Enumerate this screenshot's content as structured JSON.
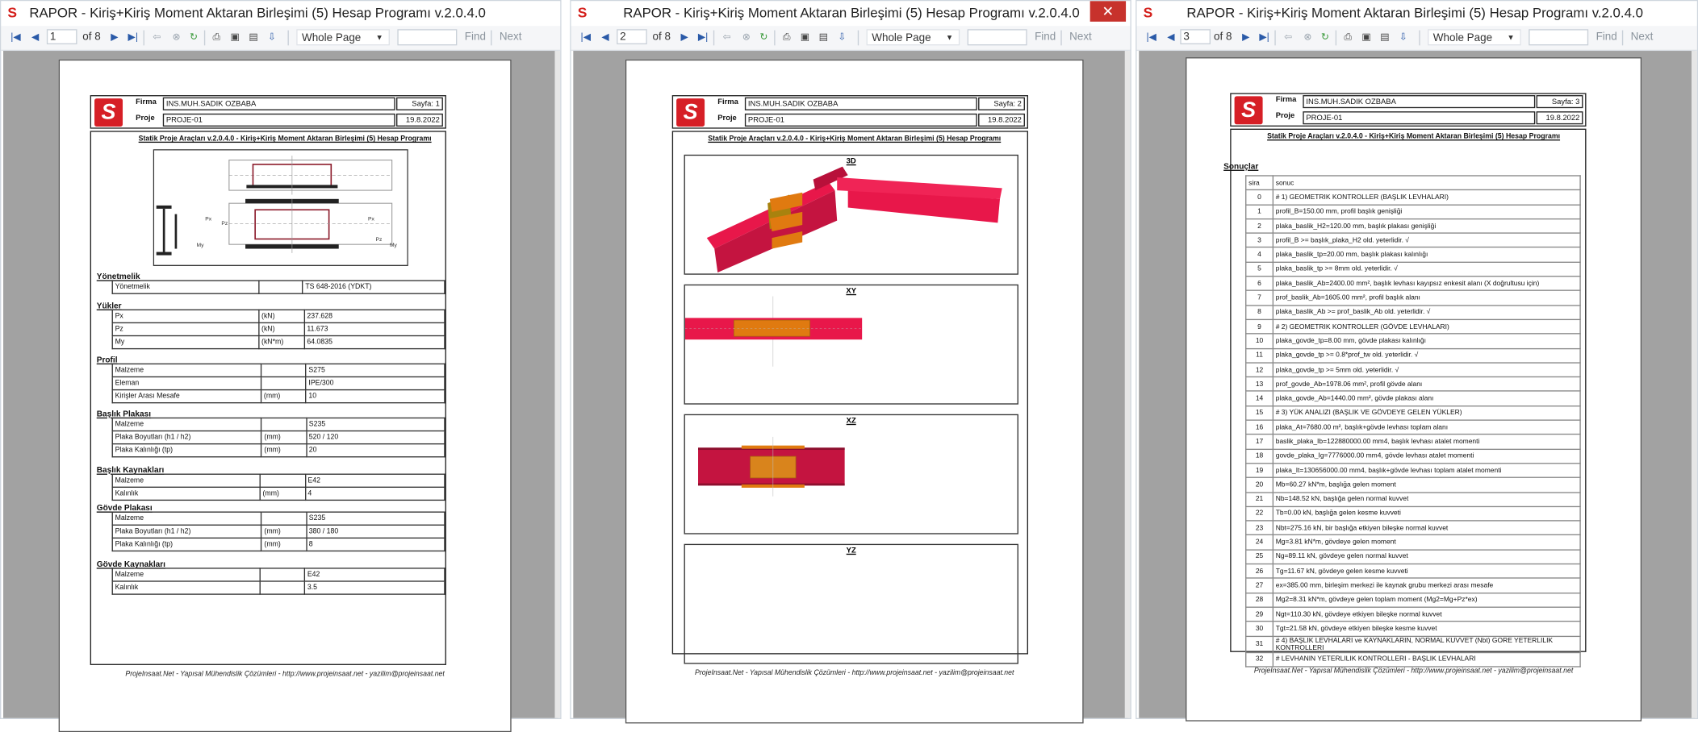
{
  "windows": [
    {
      "title": "RAPOR - Kiriş+Kiriş Moment Aktaran Birleşimi (5) Hesap Programı v.2.0.4.0",
      "page_input": "1",
      "page_of": "of 8",
      "zoom": "Whole Page",
      "find_label": "Find",
      "next_label": "Next",
      "page_label": "Sayfa: 1"
    },
    {
      "title": "RAPOR - Kiriş+Kiriş Moment Aktaran Birleşimi (5) Hesap Programı v.2.0.4.0",
      "page_input": "2",
      "page_of": "of 8",
      "zoom": "Whole Page",
      "find_label": "Find",
      "next_label": "Next",
      "page_label": "Sayfa: 2"
    },
    {
      "title": "RAPOR - Kiriş+Kiriş Moment Aktaran Birleşimi (5) Hesap Programı v.2.0.4.0",
      "page_input": "3",
      "page_of": "of 8",
      "zoom": "Whole Page",
      "find_label": "Find",
      "next_label": "Next",
      "page_label": "Sayfa: 3"
    }
  ],
  "report": {
    "firma_label": "Firma",
    "firma_value": "INS.MUH.SADIK OZBABA",
    "proje_label": "Proje",
    "proje_value": "PROJE-01",
    "date": "19.8.2022",
    "subtitle": "Statik Proje Araçları v.2.0.4.0 - Kiriş+Kiriş Moment Aktaran Birleşimi (5) Hesap Programı",
    "footer": "ProjeInsaat.Net - Yapısal Mühendislik Çözümleri - http://www.projeinsaat.net - yazilim@projeinsaat.net"
  },
  "page1": {
    "sections": [
      {
        "title": "Yönetmelik",
        "rows": [
          [
            "Yönetmelik",
            "",
            "TS 648-2016 (YDKT)"
          ]
        ]
      },
      {
        "title": "Yükler",
        "rows": [
          [
            "Px",
            "(kN)",
            "237.628"
          ],
          [
            "Pz",
            "(kN)",
            "11.673"
          ],
          [
            "My",
            "(kN*m)",
            "64.0835"
          ]
        ]
      },
      {
        "title": "Profil",
        "rows": [
          [
            "Malzeme",
            "",
            "S275"
          ],
          [
            "Eleman",
            "",
            "IPE/300"
          ],
          [
            "Kirişler Arası Mesafe",
            "(mm)",
            "10"
          ]
        ]
      },
      {
        "title": "Başlık Plakası",
        "rows": [
          [
            "Malzeme",
            "",
            "S235"
          ],
          [
            "Plaka Boyutları (h1 / h2)",
            "(mm)",
            "520 / 120"
          ],
          [
            "Plaka Kalınlığı (tp)",
            "(mm)",
            "20"
          ]
        ]
      },
      {
        "title": "Başlık Kaynakları",
        "rows": [
          [
            "Malzeme",
            "",
            "E42"
          ],
          [
            "Kalınlık",
            "(mm)",
            "4"
          ]
        ]
      },
      {
        "title": "Gövde Plakası",
        "rows": [
          [
            "Malzeme",
            "",
            "S235"
          ],
          [
            "Plaka Boyutları (h1 / h2)",
            "(mm)",
            "380 / 180"
          ],
          [
            "Plaka Kalınlığı (tp)",
            "(mm)",
            "8"
          ]
        ]
      },
      {
        "title": "Gövde Kaynakları",
        "rows": [
          [
            "Malzeme",
            "",
            "E42"
          ],
          [
            "Kalınlık",
            "",
            "3.5"
          ]
        ]
      }
    ],
    "drawing_labels": {
      "px": "Px",
      "pz": "Pz",
      "my": "My"
    }
  },
  "page2": {
    "views": [
      "3D",
      "XY",
      "XZ",
      "YZ"
    ]
  },
  "page3": {
    "section_title": "Sonuçlar",
    "columns": [
      "sira",
      "sonuc"
    ],
    "rows": [
      [
        "0",
        "# 1) GEOMETRIK KONTROLLER (BAŞLIK LEVHALARI)"
      ],
      [
        "1",
        "profil_B=150.00 mm, profil başlık genişliği"
      ],
      [
        "2",
        "plaka_baslik_H2=120.00 mm, başlık plakası genişliği"
      ],
      [
        "3",
        "profil_B >= başlık_plaka_H2 old. yeterlidir. √"
      ],
      [
        "4",
        "plaka_baslik_tp=20.00 mm, başlık plakası kalınlığı"
      ],
      [
        "5",
        "plaka_baslik_tp >= 8mm old. yeterlidir. √"
      ],
      [
        "6",
        "plaka_baslik_Ab=2400.00 mm², başlık levhası kayıpsız enkesit alanı (X doğrultusu için)"
      ],
      [
        "7",
        "prof_baslik_Ab=1605.00 mm², profil başlık alanı"
      ],
      [
        "8",
        "plaka_baslik_Ab >= prof_baslik_Ab old. yeterlidir. √"
      ],
      [
        "9",
        "# 2) GEOMETRIK KONTROLLER (GÖVDE LEVHALARI)"
      ],
      [
        "10",
        "plaka_govde_tp=8.00 mm, gövde plakası kalınlığı"
      ],
      [
        "11",
        "plaka_govde_tp >= 0.8*prof_tw old. yeterlidir. √"
      ],
      [
        "12",
        "plaka_govde_tp >= 5mm old. yeterlidir. √"
      ],
      [
        "13",
        "prof_govde_Ab=1978.06 mm², profil gövde alanı"
      ],
      [
        "14",
        "plaka_govde_Ab=1440.00 mm², gövde plakası alanı"
      ],
      [
        "15",
        "# 3) YÜK ANALIZI (BAŞLIK VE GÖVDEYE GELEN YÜKLER)"
      ],
      [
        "16",
        "plaka_At=7680.00 m², başlık+gövde levhası toplam alanı"
      ],
      [
        "17",
        "baslik_plaka_Ib=122880000.00 mm4, başlık levhası atalet momenti"
      ],
      [
        "18",
        "govde_plaka_Ig=7776000.00 mm4, gövde levhası atalet momenti"
      ],
      [
        "19",
        "plaka_It=130656000.00 mm4, başlık+gövde levhası toplam atalet momenti"
      ],
      [
        "20",
        "Mb=60.27 kN*m, başlığa gelen moment"
      ],
      [
        "21",
        "Nb=148.52 kN, başlığa gelen normal kuvvet"
      ],
      [
        "22",
        "Tb=0.00 kN, başlığa gelen kesme kuvveti"
      ],
      [
        "23",
        "Nbt=275.16 kN, bir başlığa etkiyen bileşke normal kuvvet"
      ],
      [
        "24",
        "Mg=3.81 kN*m, gövdeye gelen moment"
      ],
      [
        "25",
        "Ng=89.11 kN, gövdeye gelen normal kuvvet"
      ],
      [
        "26",
        "Tg=11.67 kN, gövdeye gelen kesme kuvveti"
      ],
      [
        "27",
        "ex=385.00 mm, birleşim merkezi ile kaynak grubu merkezi arası mesafe"
      ],
      [
        "28",
        "Mg2=8.31 kN*m, gövdeye gelen toplam moment (Mg2=Mg+Pz*ex)"
      ],
      [
        "29",
        "Ngt=110.30 kN, gövdeye etkiyen bileşke normal kuvvet"
      ],
      [
        "30",
        "Tgt=21.58 kN, gövdeye etkiyen bileşke kesme kuvvet"
      ],
      [
        "31",
        "# 4) BAŞLIK LEVHALARI ve KAYNAKLARIN, NORMAL KUVVET (Nbt) GORE YETERLILIK KONTROLLERI"
      ],
      [
        "32",
        "# LEVHANIN YETERLILIK KONTROLLERI - BAŞLIK LEVHALARI"
      ]
    ]
  },
  "colors": {
    "close_button": "#c7322c",
    "logo_red": "#d61f26",
    "beam_red": "#e8174a",
    "plate_orange": "#e07a10",
    "doc_background": "#a2a2a2"
  }
}
